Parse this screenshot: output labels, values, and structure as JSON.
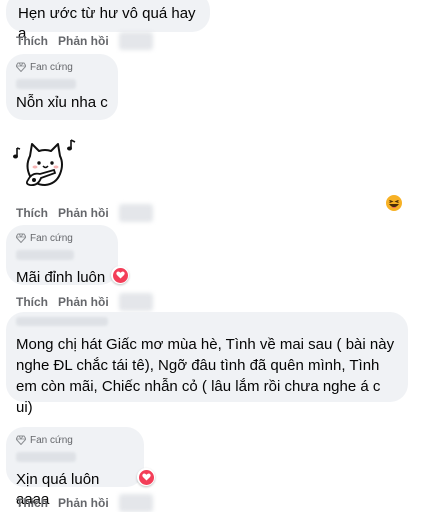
{
  "actions": {
    "like": "Thích",
    "reply": "Phản hồi"
  },
  "badge_label": "Fan cứng",
  "comments": [
    {
      "text": "Hẹn ước từ hư vô quá hay ạ"
    },
    {
      "name_partial": "Sang Mytu",
      "text": "Nỗn xỉu nha c"
    },
    {
      "text": "Mãi đỉnh luôn"
    },
    {
      "name_partial": "Phạm Việt Đức",
      "text": "Mong chị hát Giấc mơ mùa hè, Tình về mai sau ( bài này nghe ĐL chắc tái tê), Ngỡ đâu tình đã quên mình, Tình em còn mãi, Chiếc nhẫn cỏ ( lâu lắm rồi chưa nghe á c ui)"
    },
    {
      "text": "Xịn quá luôn ạaaa"
    }
  ],
  "colors": {
    "bubble": "#f0f2f5",
    "action_text": "#65676b",
    "heart": "#f33e58",
    "haha": "#f7b125"
  }
}
